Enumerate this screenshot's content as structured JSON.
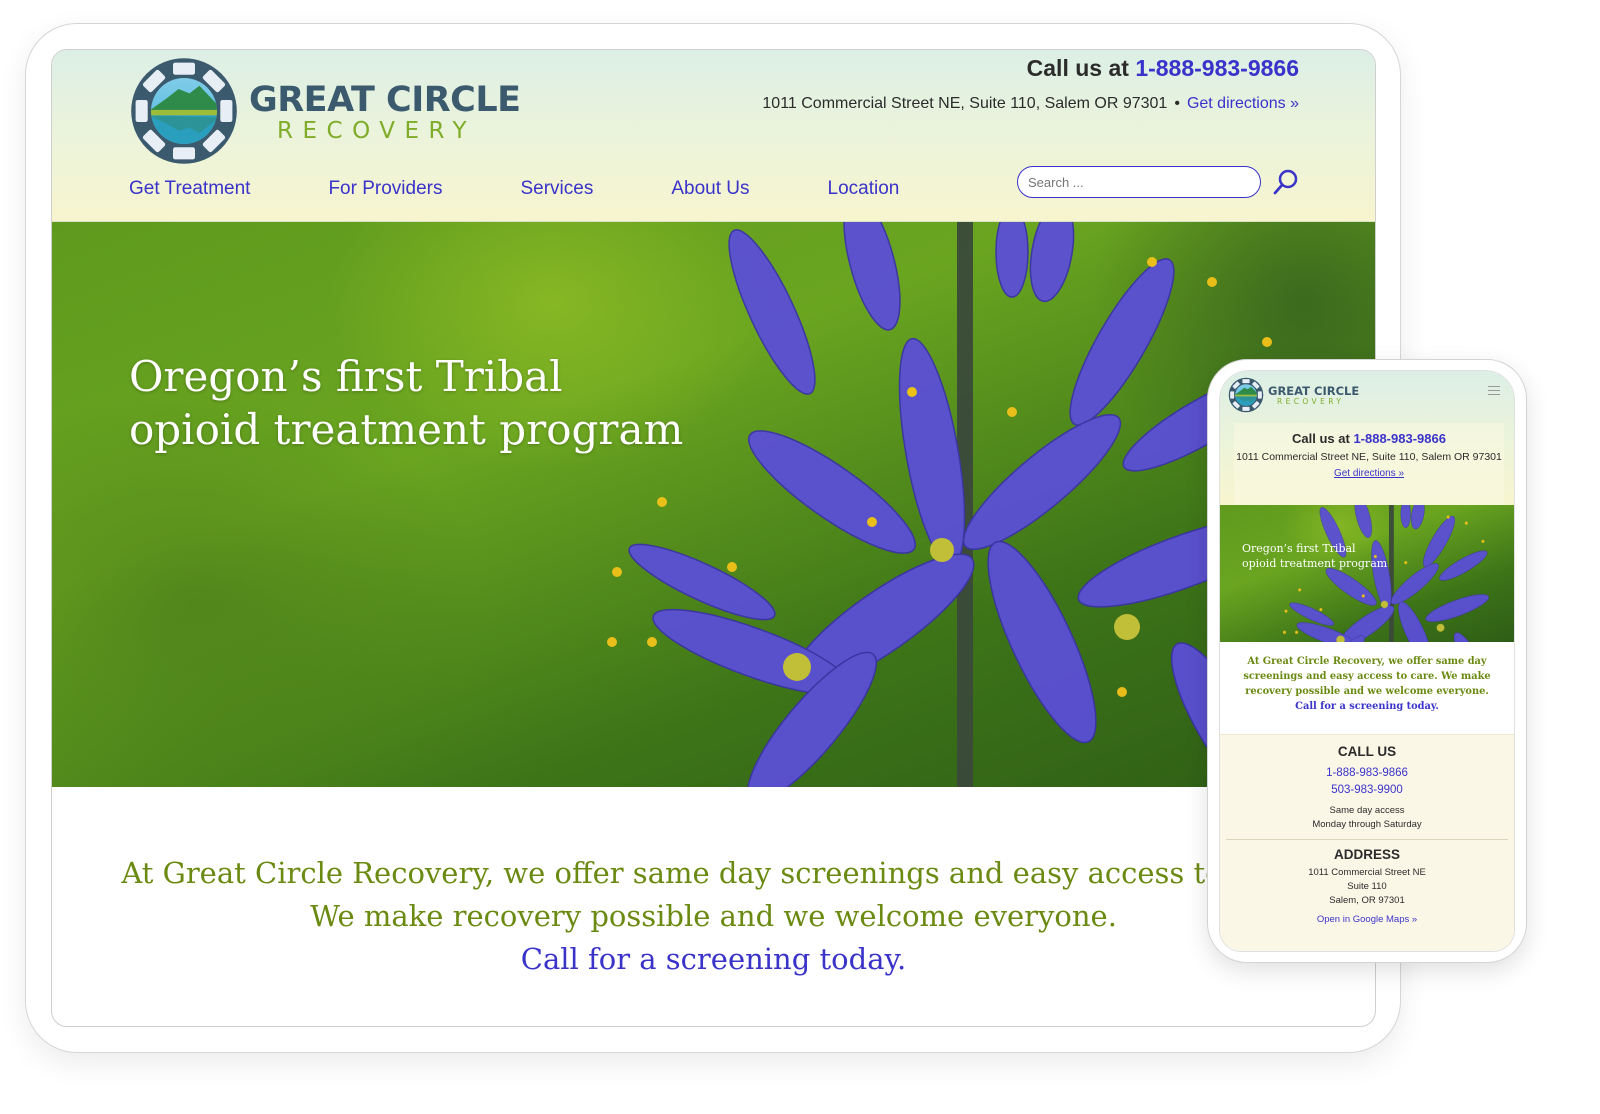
{
  "brand": {
    "name": "GREAT CIRCLE",
    "tagline": "RECOVERY"
  },
  "header": {
    "call_prefix": "Call us at",
    "phone": "1-888-983-9866",
    "address": "1011 Commercial Street NE, Suite 110, Salem OR 97301",
    "separator": "•",
    "directions_label": "Get directions »"
  },
  "nav": {
    "items": [
      {
        "label": "Get Treatment"
      },
      {
        "label": "For Providers"
      },
      {
        "label": "Services"
      },
      {
        "label": "About Us"
      },
      {
        "label": "Location"
      }
    ]
  },
  "search": {
    "placeholder": "Search ...",
    "value": "",
    "icon": "search-icon"
  },
  "hero": {
    "line1": "Oregon’s first Tribal",
    "line2": "opioid treatment program"
  },
  "intro": {
    "line1": "At Great Circle Recovery, we offer same day screenings and easy access to care.",
    "line2": "We make recovery possible and we welcome everyone.",
    "cta": "Call for a screening today."
  },
  "mobile": {
    "menu_icon": "hamburger-menu-icon",
    "intro_text": "At Great Circle Recovery, we offer same day screenings and easy access to care. We make recovery possible and we welcome everyone.",
    "cta": "Call for a screening today.",
    "call_us": {
      "heading": "CALL US",
      "phones": [
        "1-888-983-9866",
        "503-983-9900"
      ],
      "note_line1": "Same day access",
      "note_line2": "Monday through Saturday"
    },
    "address": {
      "heading": "ADDRESS",
      "line1": "1011 Commercial Street NE",
      "line2": "Suite 110",
      "line3": "Salem, OR 97301",
      "maps_label": "Open in Google Maps »"
    }
  },
  "colors": {
    "link_blue": "#3a33c9",
    "brand_navy": "#3b5a6e",
    "brand_green": "#7fad2a",
    "intro_green": "#6b8a12",
    "flower_purple": "#5b4fd6"
  }
}
